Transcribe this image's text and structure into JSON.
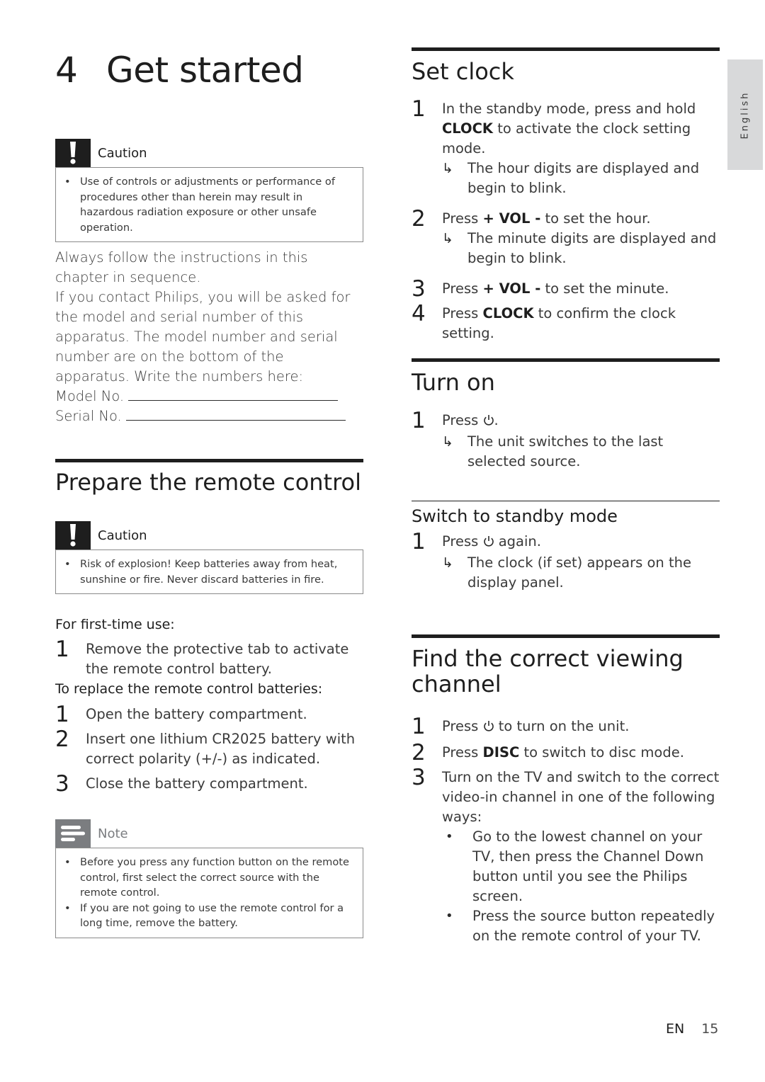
{
  "chapter": {
    "number": "4",
    "title": "Get started"
  },
  "language_tab": "English",
  "footer": {
    "lang": "EN",
    "page": "15"
  },
  "intro_caution": {
    "label": "Caution",
    "items": [
      "Use of controls or adjustments or performance of procedures other than herein may result in hazardous radiation exposure or other unsafe operation."
    ]
  },
  "intro": {
    "paragraph1": "Always follow the instructions in this chapter in sequence.",
    "paragraph2": "If you contact Philips, you will be asked for the model and serial number of this apparatus. The model number and serial number are on the bottom of the apparatus. Write the numbers here:",
    "model_label": "Model No.",
    "serial_label": "Serial No."
  },
  "remote": {
    "title": "Prepare the remote control",
    "caution": {
      "label": "Caution",
      "items": [
        "Risk of explosion! Keep batteries away from heat, sunshine or fire. Never discard batteries in fire."
      ]
    },
    "first_time_label": "For first-time use:",
    "first_time_steps": [
      {
        "n": "1",
        "text": "Remove the protective tab to activate the remote control battery."
      }
    ],
    "replace_label": "To replace the remote control batteries:",
    "replace_steps": [
      {
        "n": "1",
        "text": "Open the battery compartment."
      },
      {
        "n": "2",
        "text": "Insert one lithium CR2025 battery with correct polarity (+/-) as indicated."
      },
      {
        "n": "3",
        "text": "Close the battery compartment."
      }
    ],
    "note": {
      "label": "Note",
      "items": [
        "Before you press any function button on the remote control, first select the correct source with the remote control.",
        "If you are not going to use the remote control for a long time, remove the battery."
      ]
    }
  },
  "set_clock": {
    "title": "Set clock",
    "steps": [
      {
        "n": "1",
        "pre": "In the standby mode, press and hold ",
        "key": "CLOCK",
        "post": " to activate the clock setting mode.",
        "result": "The hour digits are displayed and begin to blink."
      },
      {
        "n": "2",
        "pre": "Press ",
        "key": "+ VOL -",
        "post": " to set the hour.",
        "result": "The minute digits are displayed and begin to blink."
      },
      {
        "n": "3",
        "pre": "Press ",
        "key": "+ VOL -",
        "post": " to set the minute."
      },
      {
        "n": "4",
        "pre": "Press ",
        "key": "CLOCK",
        "post": " to confirm the clock setting."
      }
    ]
  },
  "turn_on": {
    "title": "Turn on",
    "steps": [
      {
        "n": "1",
        "pre": "Press ",
        "icon": "power-icon",
        "post": ".",
        "result": "The unit switches to the last selected source."
      }
    ],
    "standby": {
      "title": "Switch to standby mode",
      "steps": [
        {
          "n": "1",
          "pre": "Press ",
          "icon": "power-icon",
          "post": " again.",
          "result": "The clock (if set) appears on the display panel."
        }
      ]
    }
  },
  "viewing_channel": {
    "title": "Find the correct viewing channel",
    "steps": [
      {
        "n": "1",
        "pre": "Press ",
        "icon": "power-icon",
        "post": " to turn on the unit."
      },
      {
        "n": "2",
        "pre": "Press ",
        "key": "DISC",
        "post": " to switch to disc mode."
      },
      {
        "n": "3",
        "pre": "Turn on the TV and switch to the correct video-in channel in one of the following ways:"
      }
    ],
    "ways": [
      "Go to the lowest channel on your TV, then press the Channel Down button until you see the Philips screen.",
      "Press the source button repeatedly on the remote control of your TV."
    ]
  },
  "colors": {
    "text": "#1e1e1e",
    "caution_icon": "#1e1e1e",
    "note_icon": "#7b7d80",
    "lang_tab": "#d8d9da"
  }
}
